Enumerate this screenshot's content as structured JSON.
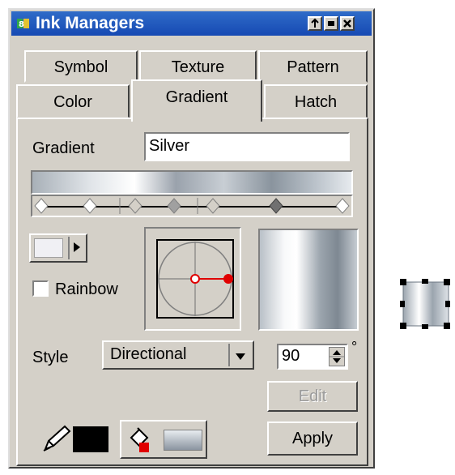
{
  "window": {
    "title": "Ink Managers"
  },
  "tabs": {
    "back_row": [
      "Symbol",
      "Texture",
      "Pattern"
    ],
    "front_row": [
      "Color",
      "Gradient",
      "Hatch"
    ],
    "active": "Gradient"
  },
  "gradient": {
    "label": "Gradient",
    "name_value": "Silver",
    "rainbow_label": "Rainbow",
    "rainbow_checked": false
  },
  "style": {
    "label": "Style",
    "selected": "Directional",
    "angle": "90",
    "degree_symbol": "°"
  },
  "buttons": {
    "edit": "Edit",
    "apply": "Apply"
  },
  "icons": {
    "title_icon": "ink-manager-icon",
    "pen": "pen-icon",
    "fill_bucket": "fill-bucket-icon"
  },
  "colors": {
    "titlebar": "#1f57c0",
    "stroke_swatch": "#000000",
    "direction_handle": "#e00000"
  }
}
